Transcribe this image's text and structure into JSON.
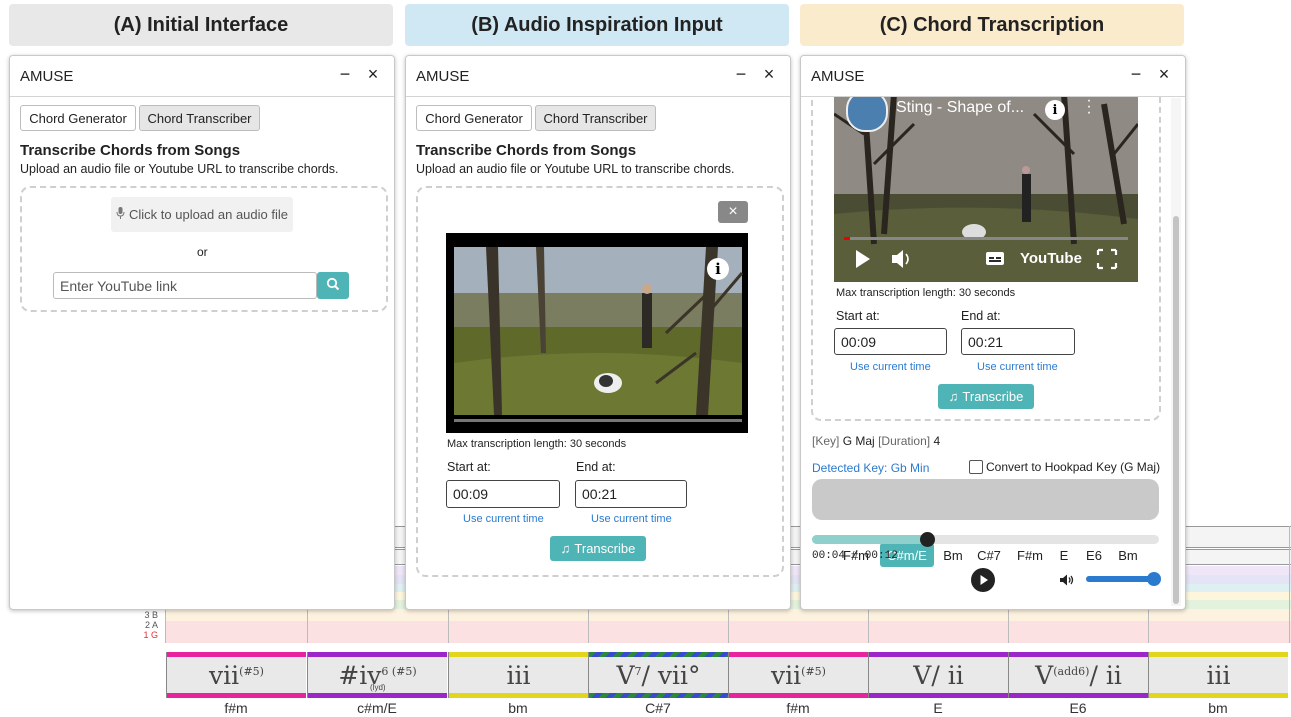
{
  "headers": {
    "a": "(A) Initial Interface",
    "b": "(B) Audio Inspiration Input",
    "c": "(C) Chord Transcription"
  },
  "colors": {
    "header_a": "#e8e8e8",
    "header_b": "#cfe8f3",
    "header_c": "#faebcd",
    "accent": "#4fb4b6",
    "link": "#2a7bd0"
  },
  "window": {
    "title": "AMUSE",
    "minimize": "−",
    "close": "×"
  },
  "tabs": {
    "generator": "Chord Generator",
    "transcriber": "Chord Transcriber"
  },
  "transcriber": {
    "heading": "Transcribe Chords from Songs",
    "description": "Upload an audio file or Youtube URL to transcribe chords.",
    "upload_label": "Click to upload an audio file",
    "or": "or",
    "youtube_placeholder": "Enter YouTube link",
    "dialog_close": "×",
    "max_length": "Max transcription length: 30 seconds",
    "start_label": "Start at:",
    "end_label": "End at:",
    "start_value": "00:09",
    "end_value": "00:21",
    "use_current": "Use current time",
    "transcribe": "Transcribe"
  },
  "video_c": {
    "title": "Sting - Shape of...",
    "youtube": "YouTube",
    "progress_fraction": 0.02
  },
  "result": {
    "key_label": "[Key]",
    "key_value": "G Maj",
    "duration_label": "[Duration]",
    "duration_value": "4",
    "detected": "Detected Key: Gb Min",
    "convert": "Convert to Hookpad Key (G Maj)",
    "chords": [
      "F#m",
      "C#m/E",
      "Bm",
      "C#7",
      "F#m",
      "E",
      "E6",
      "Bm"
    ],
    "selected_chord_index": 1,
    "time": "00:04 / 00:12",
    "progress_fraction": 0.33,
    "volume_fraction": 1.0
  },
  "strings": [
    "3 B",
    "2 A",
    "1 G"
  ],
  "chord_track": [
    {
      "roman": "vii",
      "sup": "(#5)",
      "sub": "",
      "label": "f#m",
      "top": "#e8239e",
      "bottom": "#e8239e"
    },
    {
      "roman": "#iv",
      "sup": "6 (#5)",
      "sub": "(lyd)",
      "label": "c#m/E",
      "top": "#9b27c9",
      "bottom": "#9b27c9"
    },
    {
      "roman": "iii",
      "sup": "",
      "sub": "",
      "label": "bm",
      "top": "#e2d61c",
      "bottom": "#e2d61c"
    },
    {
      "roman": "V",
      "sup": "7",
      "sub": "",
      "extra": "/ vii°",
      "label": "C#7",
      "top": "stripe",
      "bottom": "stripe"
    },
    {
      "roman": "vii",
      "sup": "(#5)",
      "sub": "",
      "label": "f#m",
      "top": "#e8239e",
      "bottom": "#e8239e"
    },
    {
      "roman": "V",
      "sup": "",
      "sub": "",
      "extra": "/ ii",
      "label": "E",
      "top": "#9b27c9",
      "bottom": "#9b27c9"
    },
    {
      "roman": "V",
      "sup": "(add6)",
      "sub": "",
      "extra": "/ ii",
      "label": "E6",
      "top": "#9b27c9",
      "bottom": "#9b27c9"
    },
    {
      "roman": "iii",
      "sup": "",
      "sub": "",
      "label": "bm",
      "top": "#e2d61c",
      "bottom": "#e2d61c"
    }
  ]
}
